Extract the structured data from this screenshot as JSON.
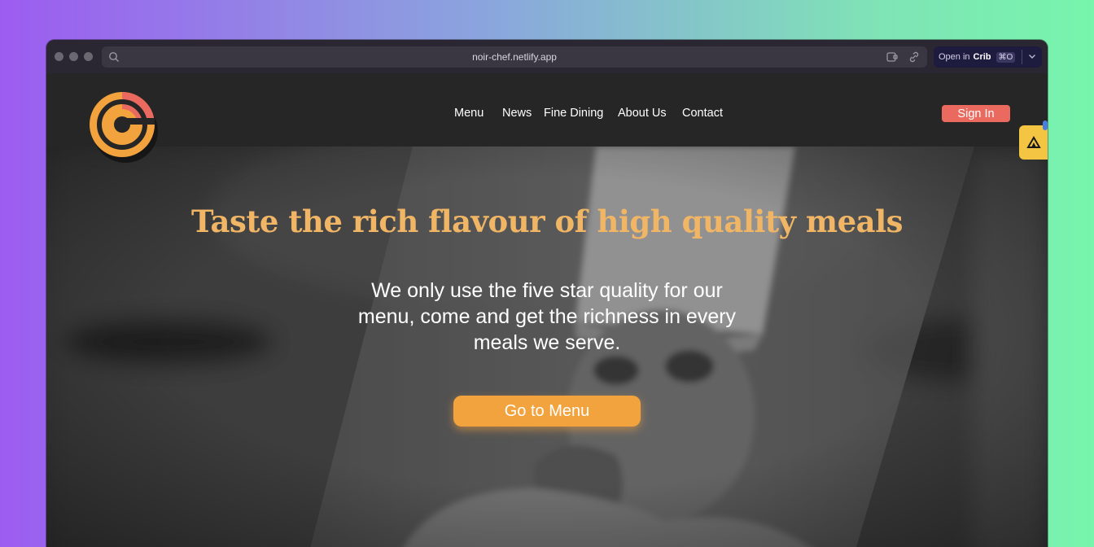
{
  "browser": {
    "url": "noir-chef.netlify.app",
    "crib_button": {
      "prefix": "Open in",
      "brand": "Crib",
      "shortcut": "⌘O"
    }
  },
  "nav": {
    "links": [
      "Menu",
      "News",
      "Fine Dining",
      "About Us",
      "Contact"
    ],
    "signin_label": "Sign In"
  },
  "hero": {
    "headline": "Taste the rich flavour of high quality meals",
    "subtext": "We only use the five star quality for our menu, come and get the richness in every meals we serve.",
    "cta_label": "Go to Menu"
  },
  "colors": {
    "accent_orange": "#f2a33d",
    "headline_gold": "#f0b565",
    "signin_coral": "#ea6a5f",
    "nav_bg": "#262626"
  }
}
